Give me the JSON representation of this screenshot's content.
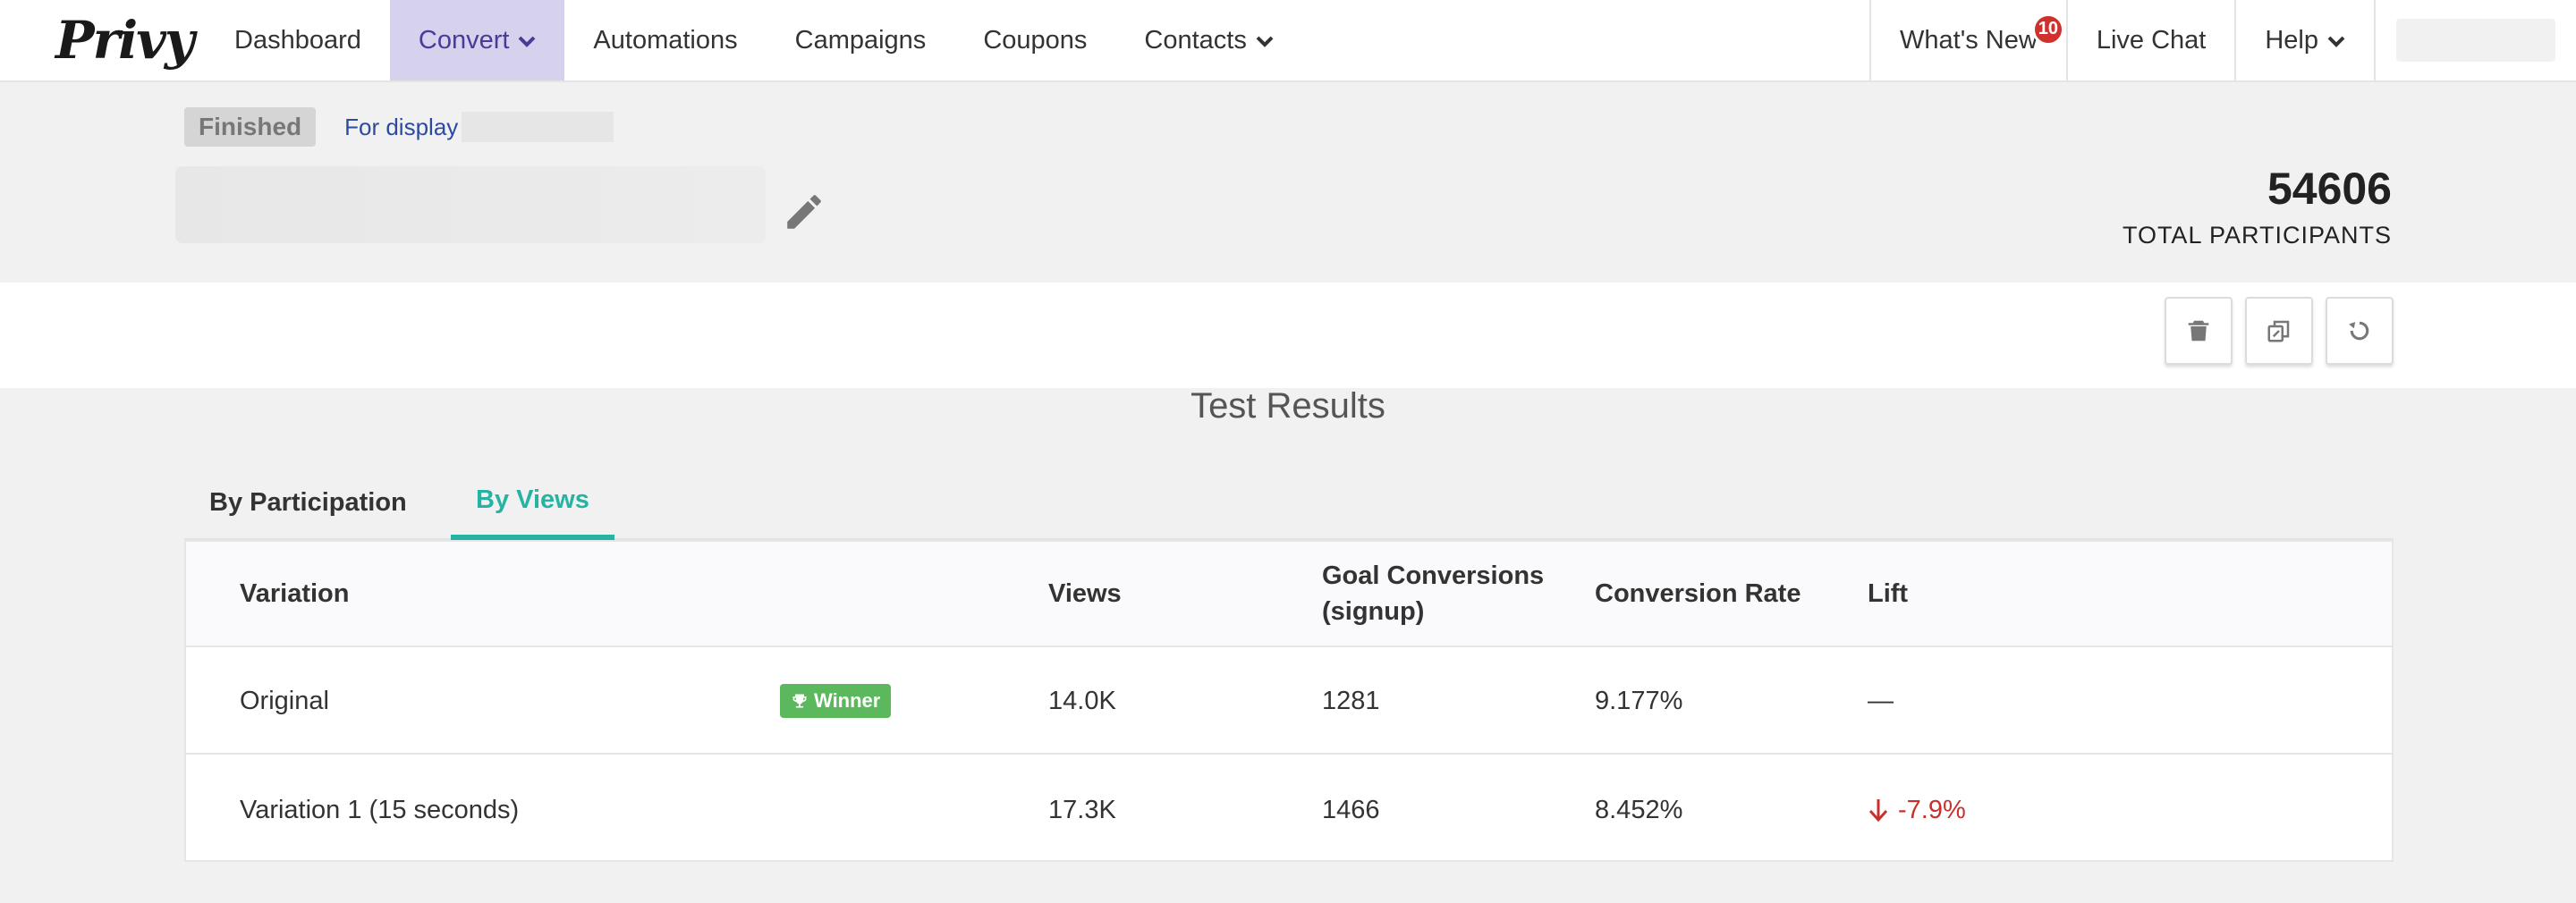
{
  "nav": {
    "logo": "Privy",
    "items": [
      {
        "label": "Dashboard",
        "active": false,
        "dropdown": false
      },
      {
        "label": "Convert",
        "active": true,
        "dropdown": true
      },
      {
        "label": "Automations",
        "active": false,
        "dropdown": false
      },
      {
        "label": "Campaigns",
        "active": false,
        "dropdown": false
      },
      {
        "label": "Coupons",
        "active": false,
        "dropdown": false
      },
      {
        "label": "Contacts",
        "active": false,
        "dropdown": true
      }
    ],
    "right": {
      "whats_new": "What's New",
      "whats_new_count": "10",
      "live_chat": "Live Chat",
      "help": "Help"
    }
  },
  "header": {
    "status": "Finished",
    "display_label": "For display",
    "total_participants": "54606",
    "total_label": "TOTAL PARTICIPANTS"
  },
  "toolbar": {
    "icons": [
      "trash-icon",
      "copy-icon",
      "reset-icon"
    ]
  },
  "results": {
    "title": "Test Results",
    "tabs": [
      {
        "label": "By Participation",
        "active": false
      },
      {
        "label": "By Views",
        "active": true
      }
    ],
    "columns": {
      "variation": "Variation",
      "views": "Views",
      "goal_line1": "Goal Conversions",
      "goal_line2": "(signup)",
      "rate": "Conversion Rate",
      "lift": "Lift"
    },
    "rows": [
      {
        "variation": "Original",
        "winner": "Winner",
        "views": "14.0K",
        "conversions": "1281",
        "rate": "9.177%",
        "lift": "—"
      },
      {
        "variation": "Variation 1 (15 seconds)",
        "winner": "",
        "views": "17.3K",
        "conversions": "1466",
        "rate": "8.452%",
        "lift": "-7.9%"
      }
    ]
  },
  "colors": {
    "accent_teal": "#26b3a3",
    "nav_active_bg": "#d6d1ec",
    "winner_green": "#5cb85c",
    "negative_red": "#c9302c"
  }
}
